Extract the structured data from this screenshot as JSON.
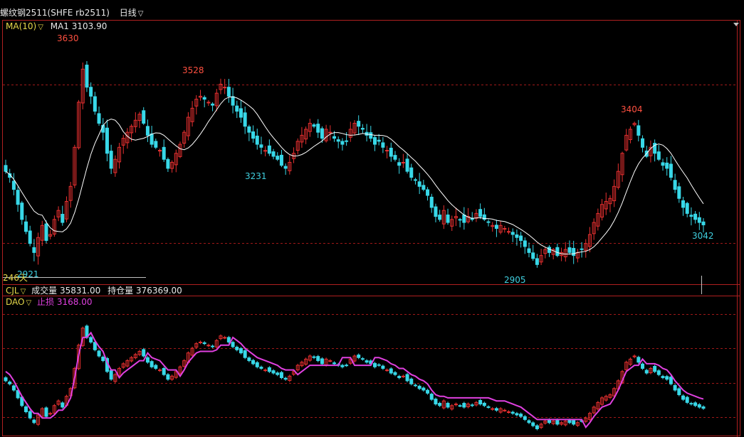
{
  "header": {
    "instrument": "螺纹钢2511(SHFE rb2511)",
    "period": "日线"
  },
  "main_panel": {
    "indicator": "MA(10)",
    "ma_label": "MA1",
    "ma_value": "3103.90",
    "bar_count": "246天",
    "annotations": {
      "high_left": "3630",
      "low_left": "2921",
      "high_mid": "3528",
      "low_mid": "3231",
      "low_bottom": "2905",
      "high_right": "3404",
      "last_low": "3042"
    }
  },
  "volume_panel": {
    "indicator": "CJL",
    "volume_label": "成交量",
    "volume_value": "35831.00",
    "oi_label": "持仓量",
    "oi_value": "376369.00"
  },
  "lower_panel": {
    "indicator": "DAO",
    "stop_label": "止损",
    "stop_value": "3168.00"
  },
  "colors": {
    "up": "#e83030",
    "down": "#38d8e8",
    "ma": "#ffffff",
    "stop_line": "#e040e0",
    "grid": "#a01818",
    "frame": "#b02020",
    "annot_high": "#ff5040",
    "annot_low": "#40d0e0"
  },
  "chart_data": {
    "type": "candlestick",
    "series": [
      {
        "name": "MA1",
        "values": [
          3103.9
        ]
      },
      {
        "name": "止损",
        "values": [
          3168.0
        ]
      }
    ],
    "closes": [
      3220,
      3200,
      3160,
      3110,
      3060,
      3020,
      2980,
      2950,
      3000,
      3040,
      2990,
      3010,
      3060,
      3090,
      3050,
      3120,
      3170,
      3300,
      3450,
      3560,
      3500,
      3470,
      3420,
      3380,
      3350,
      3280,
      3230,
      3260,
      3300,
      3330,
      3350,
      3370,
      3390,
      3410,
      3380,
      3340,
      3310,
      3300,
      3290,
      3260,
      3230,
      3250,
      3280,
      3310,
      3350,
      3400,
      3430,
      3460,
      3470,
      3460,
      3450,
      3440,
      3480,
      3510,
      3500,
      3470,
      3440,
      3420,
      3400,
      3370,
      3350,
      3330,
      3310,
      3300,
      3290,
      3280,
      3270,
      3260,
      3240,
      3230,
      3250,
      3280,
      3320,
      3340,
      3360,
      3380,
      3370,
      3350,
      3330,
      3360,
      3350,
      3330,
      3320,
      3310,
      3320,
      3360,
      3380,
      3370,
      3360,
      3340,
      3330,
      3310,
      3320,
      3300,
      3290,
      3270,
      3260,
      3240,
      3250,
      3220,
      3200,
      3190,
      3170,
      3160,
      3140,
      3100,
      3070,
      3060,
      3090,
      3050,
      3060,
      3070,
      3060,
      3050,
      3070,
      3060,
      3080,
      3070,
      3060,
      3050,
      3040,
      3030,
      3040,
      3030,
      3020,
      3010,
      3000,
      2990,
      2970,
      2950,
      2930,
      2910,
      2940,
      2960,
      2950,
      2960,
      2940,
      2950,
      2960,
      2950,
      2940,
      2950,
      2960,
      2980,
      3010,
      3050,
      3080,
      3110,
      3120,
      3130,
      3170,
      3220,
      3280,
      3340,
      3360,
      3380,
      3340,
      3300,
      3270,
      3300,
      3280,
      3260,
      3240,
      3230,
      3200,
      3160,
      3130,
      3100,
      3080,
      3070,
      3060,
      3050,
      3042
    ]
  }
}
